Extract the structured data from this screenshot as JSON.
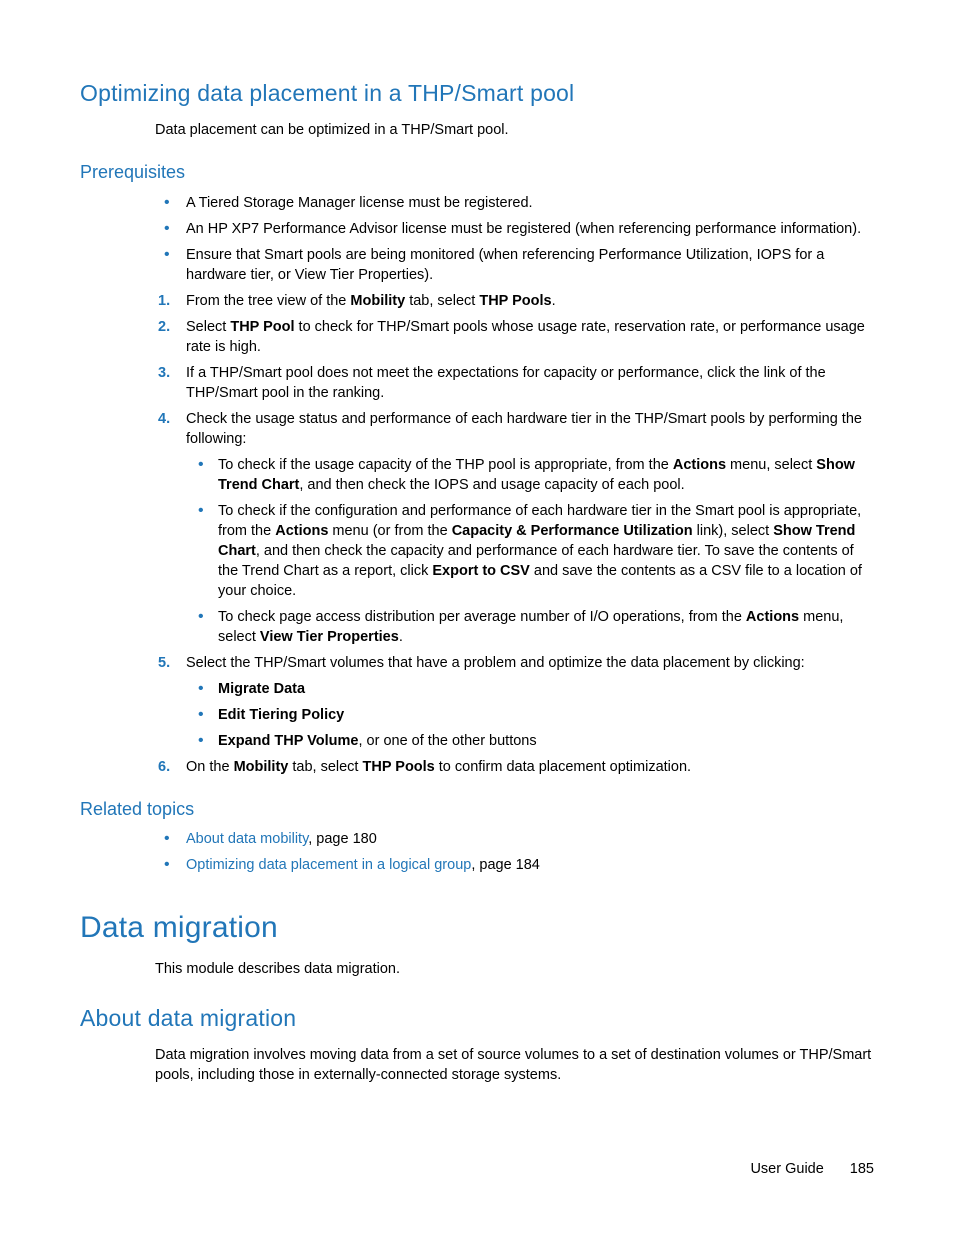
{
  "section1": {
    "title": "Optimizing data placement in a THP/Smart pool",
    "intro": "Data placement can be optimized in a THP/Smart pool.",
    "prereq_title": "Prerequisites",
    "prereq_items": [
      "A Tiered Storage Manager license must be registered.",
      "An HP XP7 Performance Advisor license must be registered (when referencing performance information).",
      "Ensure that Smart pools are being monitored (when referencing Performance Utilization, IOPS for a hardware tier, or View Tier Properties)."
    ],
    "steps": [
      {
        "num": "1.",
        "parts": [
          "From the tree view of the ",
          "Mobility",
          " tab, select ",
          "THP Pools",
          "."
        ]
      },
      {
        "num": "2.",
        "parts": [
          "Select ",
          "THP Pool",
          " to check for THP/Smart pools whose usage rate, reservation rate, or performance usage rate is high."
        ]
      },
      {
        "num": "3.",
        "parts": [
          "If a THP/Smart pool does not meet the expectations for capacity or performance, click the link of the THP/Smart pool in the ranking."
        ]
      },
      {
        "num": "4.",
        "parts": [
          "Check the usage status and performance of each hardware tier in the THP/Smart pools by performing the following:"
        ],
        "sub": [
          {
            "parts": [
              "To check if the usage capacity of the THP pool is appropriate, from the ",
              "Actions",
              " menu, select ",
              "Show Trend Chart",
              ", and then check the IOPS and usage capacity of each pool."
            ]
          },
          {
            "parts": [
              "To check if the configuration and performance of each hardware tier in the Smart pool is appropriate, from the ",
              "Actions",
              " menu (or from the ",
              "Capacity & Performance Utilization",
              " link), select ",
              "Show Trend Chart",
              ", and then check the capacity and performance of each hardware tier. To save the contents of the Trend Chart as a report, click ",
              "Export to CSV",
              " and save the contents as a CSV file to a location of your choice."
            ]
          },
          {
            "parts": [
              "To check page access distribution per average number of I/O operations, from the ",
              "Actions",
              " menu, select ",
              "View Tier Properties",
              "."
            ]
          }
        ]
      },
      {
        "num": "5.",
        "parts": [
          "Select the THP/Smart volumes that have a problem and optimize the data placement by clicking:"
        ],
        "sub": [
          {
            "parts": [
              "",
              "Migrate Data",
              ""
            ]
          },
          {
            "parts": [
              "",
              "Edit Tiering Policy",
              ""
            ]
          },
          {
            "parts": [
              "",
              "Expand THP Volume",
              ", or one of the other buttons"
            ]
          }
        ]
      },
      {
        "num": "6.",
        "parts": [
          "On the ",
          "Mobility",
          " tab, select ",
          "THP Pools",
          " to confirm data placement optimization."
        ]
      }
    ],
    "related_title": "Related topics",
    "related": [
      {
        "link": "About data mobility",
        "tail": ", page 180"
      },
      {
        "link": "Optimizing data placement in a logical group",
        "tail": ", page 184"
      }
    ]
  },
  "section2": {
    "title": "Data migration",
    "intro": "This module describes data migration.",
    "sub_title": "About data migration",
    "sub_intro": "Data migration involves moving data from a set of source volumes to a set of destination volumes or THP/Smart pools, including those in externally-connected storage systems."
  },
  "footer": {
    "label": "User Guide",
    "page": "185"
  }
}
